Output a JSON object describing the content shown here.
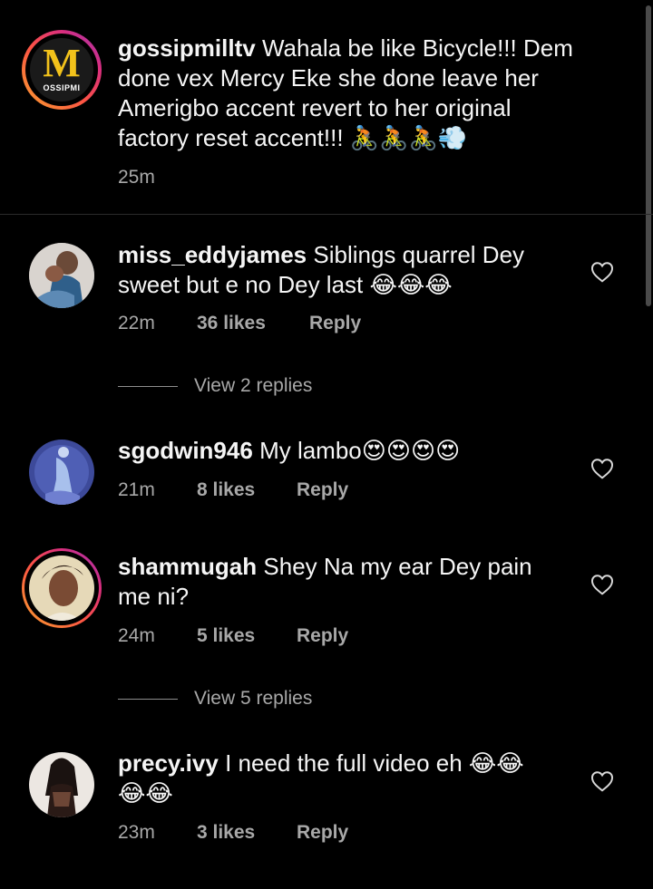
{
  "caption": {
    "username": "gossipmilltv",
    "logo_letter": "M",
    "logo_word": "OSSIPMI",
    "text": "Wahala be like Bicycle!!! Dem done vex Mercy Eke she done leave her Amerigbo accent revert to her original factory reset accent!!! 🚴🏾‍♀️🚴🏾‍♀️🚴🏾‍♀️💨",
    "line1": "Wahala be like Bicycle!!! Dem",
    "line2": "done vex Mercy Eke she done leave her",
    "line3": "Amerigbo accent revert to her original",
    "line4": "factory reset accent!!! 🚴🚴🚴💨",
    "time": "25m"
  },
  "comments": [
    {
      "username": "miss_eddyjames",
      "line1": "Siblings quarrel Dey",
      "line2": "sweet but e no Dey last 😂😂😂",
      "time": "22m",
      "likes": "36 likes",
      "reply": "Reply",
      "view_replies": "View 2 replies"
    },
    {
      "username": "sgodwin946",
      "line1": "My lambo😍😍😍😍",
      "time": "21m",
      "likes": "8 likes",
      "reply": "Reply"
    },
    {
      "username": "shammugah",
      "line1": "Shey Na my ear Dey pain",
      "line2": "me ni?",
      "time": "24m",
      "likes": "5 likes",
      "reply": "Reply",
      "view_replies": "View 5 replies"
    },
    {
      "username": "precy.ivy",
      "line1": "I need the full video eh 😂😂",
      "line2": "😂😂",
      "time": "23m",
      "likes": "3 likes",
      "reply": "Reply"
    }
  ],
  "colors": {
    "background": "#000000",
    "text": "#f5f5f5",
    "muted": "#a8a8a8",
    "logo_yellow": "#f2c21b"
  },
  "icons": {
    "like": "heart-outline-icon"
  }
}
